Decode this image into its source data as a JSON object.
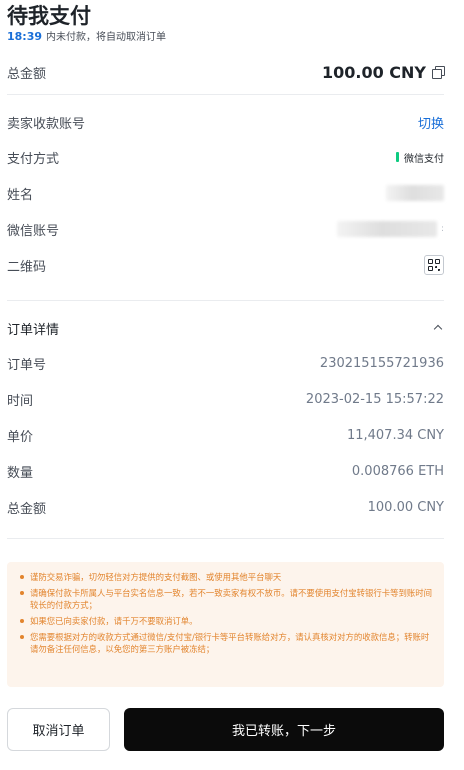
{
  "header": {
    "title": "待我支付",
    "countdown_time": "18:39",
    "countdown_text": "内未付款，将自动取消订单"
  },
  "summary": {
    "total_label": "总金额",
    "total_value": "100.00 CNY"
  },
  "seller": {
    "account_label": "卖家收款账号",
    "switch_label": "切换",
    "method_label": "支付方式",
    "method_value": "微信支付",
    "name_label": "姓名",
    "wechat_label": "微信账号",
    "wechat_tail": ":",
    "qr_label": "二维码"
  },
  "order": {
    "section_title": "订单详情",
    "rows": [
      {
        "label": "订单号",
        "value": "230215155721936"
      },
      {
        "label": "时间",
        "value": "2023-02-15 15:57:22"
      },
      {
        "label": "单价",
        "value": "11,407.34 CNY"
      },
      {
        "label": "数量",
        "value": "0.008766 ETH"
      },
      {
        "label": "总金额",
        "value": "100.00 CNY"
      }
    ]
  },
  "notices": [
    "谨防交易诈骗，切勿轻信对方提供的支付截图、或使用其他平台聊天",
    "请确保付款卡所属人与平台实名信息一致，若不一致卖家有权不放币。请不要使用支付宝转银行卡等到账时间较长的付款方式；",
    "如果您已向卖家付款，请千万不要取消订单。",
    "您需要根据对方的收款方式通过微信/支付宝/银行卡等平台转账给对方，请认真核对对方的收款信息；转账时请勿备注任何信息，以免您的第三方账户被冻结；"
  ],
  "actions": {
    "cancel_label": "取消订单",
    "confirm_label": "我已转账，下一步"
  },
  "colors": {
    "accent_blue": "#1a6fd8",
    "wechat_green": "#0ecb81",
    "notice_orange": "#e2842d",
    "notice_bg": "#fdf4ec",
    "primary_button": "#0b0b0b"
  }
}
